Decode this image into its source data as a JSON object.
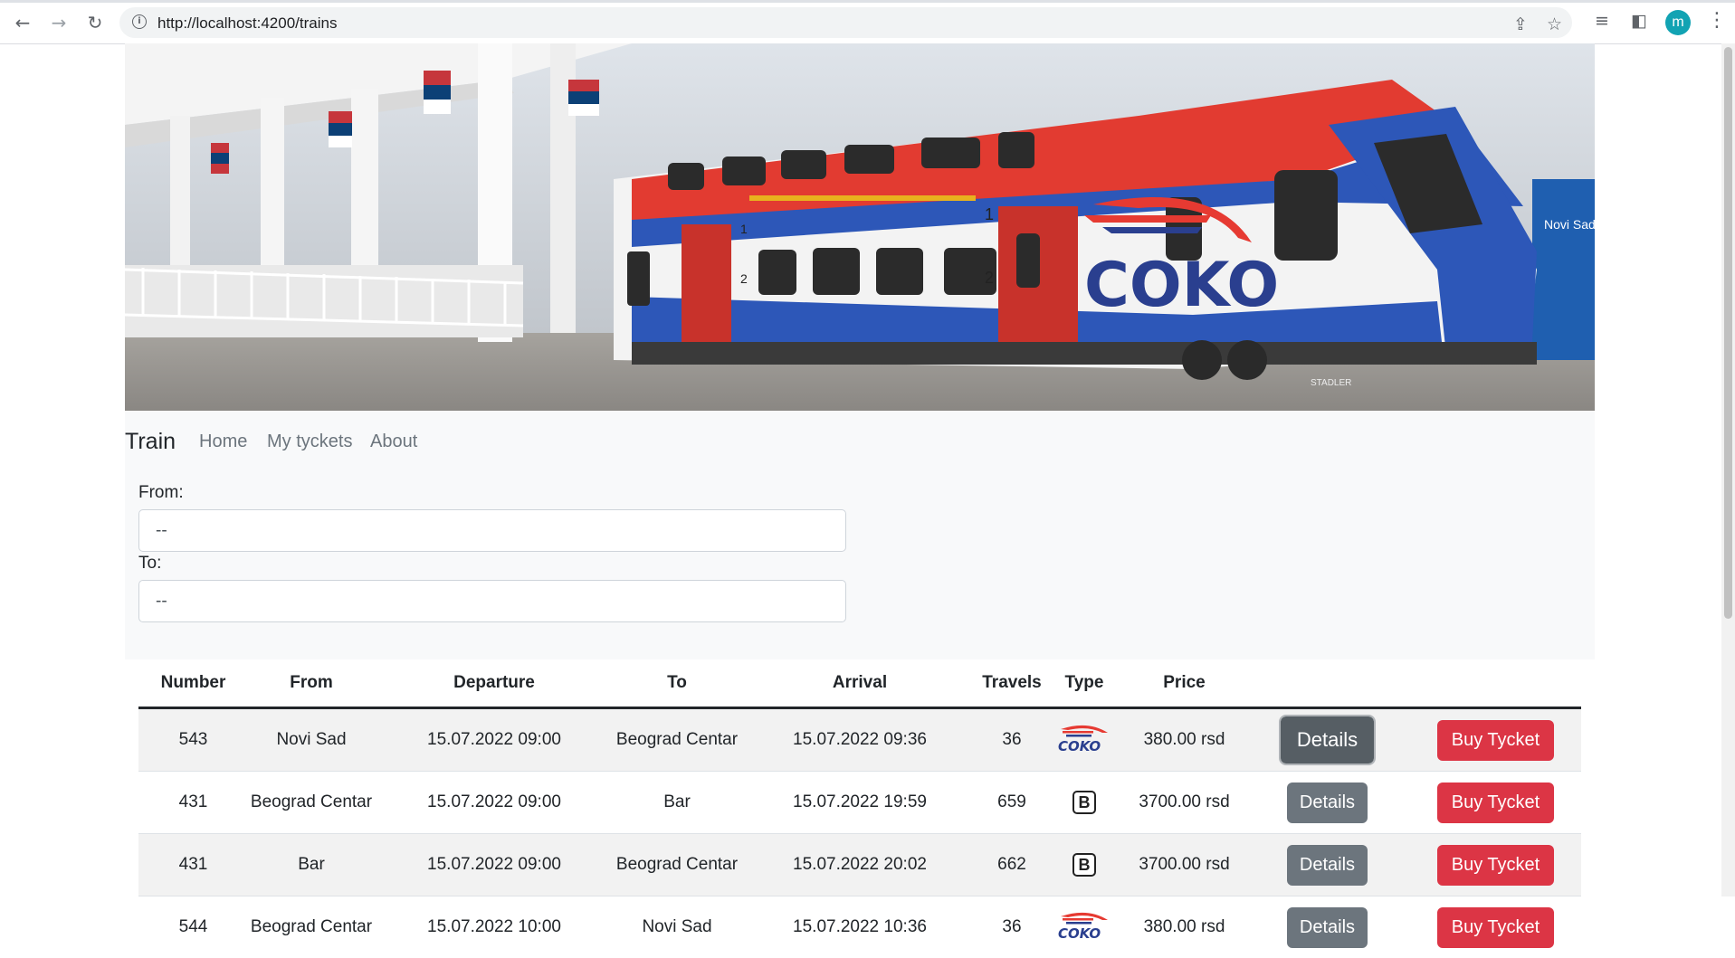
{
  "browser": {
    "url": "http://localhost:4200/trains",
    "avatar_letter": "m",
    "icons": [
      "back-icon",
      "forward-icon",
      "reload-icon",
      "info-icon",
      "share-icon",
      "star-icon",
      "tab-search-icon",
      "sidebar-icon",
      "menu-icon"
    ]
  },
  "banner": {
    "logo_text": "COKO",
    "station_sign": "Novi Sad",
    "car_numbers": [
      "1",
      "2",
      "1",
      "2"
    ],
    "maker_plate": "STADLER"
  },
  "navbar": {
    "brand": "Train",
    "links": [
      "Home",
      "My tyckets",
      "About"
    ]
  },
  "filters": {
    "from_label": "From:",
    "from_value": "--",
    "to_label": "To:",
    "to_value": "--"
  },
  "table": {
    "headers": [
      "Number",
      "From",
      "Departure",
      "To",
      "Arrival",
      "Travels",
      "Type",
      "Price",
      "",
      ""
    ],
    "details_label": "Details",
    "buy_label": "Buy Tycket",
    "rows": [
      {
        "number": "543",
        "from": "Novi Sad",
        "departure": "15.07.2022 09:00",
        "to": "Beograd Centar",
        "arrival": "15.07.2022 09:36",
        "travels": "36",
        "type": "COKO",
        "price": "380.00 rsd"
      },
      {
        "number": "431",
        "from": "Beograd Centar",
        "departure": "15.07.2022 09:00",
        "to": "Bar",
        "arrival": "15.07.2022 19:59",
        "travels": "659",
        "type": "B",
        "price": "3700.00 rsd"
      },
      {
        "number": "431",
        "from": "Bar",
        "departure": "15.07.2022 09:00",
        "to": "Beograd Centar",
        "arrival": "15.07.2022 20:02",
        "travels": "662",
        "type": "B",
        "price": "3700.00 rsd"
      },
      {
        "number": "544",
        "from": "Beograd Centar",
        "departure": "15.07.2022 10:00",
        "to": "Novi Sad",
        "arrival": "15.07.2022 10:36",
        "travels": "36",
        "type": "COKO",
        "price": "380.00 rsd"
      }
    ]
  },
  "colors": {
    "details_button": "#6c757d",
    "buy_button": "#dc3545",
    "navbar_bg": "#f8f9fa",
    "coko_blue": "#2a3f8f",
    "coko_red": "#e63a32"
  }
}
